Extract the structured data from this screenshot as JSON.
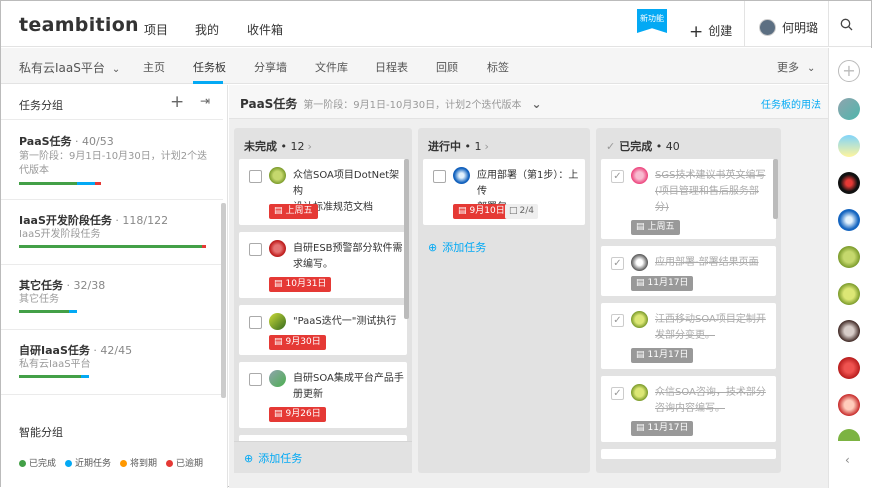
{
  "header": {
    "logo": "teambition",
    "nav": [
      "项目",
      "我的",
      "收件箱"
    ],
    "new_badge": "新功能",
    "create_label": "创建",
    "user_name": "何明璐"
  },
  "subnav": {
    "project": "私有云IaaS平台",
    "tabs": [
      "主页",
      "任务板",
      "分享墙",
      "文件库",
      "日程表",
      "回顾",
      "标签"
    ],
    "more": "更多"
  },
  "left": {
    "header": "任务分组",
    "groups": [
      {
        "name": "PaaS任务",
        "count": " · 40/53",
        "desc": "第一阶段：9月1日-10月30日，计划2个迭代版本"
      },
      {
        "name": "IaaS开发阶段任务",
        "count": " · 118/122",
        "desc": "IaaS开发阶段任务"
      },
      {
        "name": "其它任务",
        "count": " · 32/38",
        "desc": "其它任务"
      },
      {
        "name": "自研IaaS任务",
        "count": " · 42/45",
        "desc": "私有云IaaS平台"
      }
    ],
    "smart_group": "智能分组",
    "legend": [
      {
        "label": "已完成",
        "color": "#43a047"
      },
      {
        "label": "近期任务",
        "color": "#03a9f4"
      },
      {
        "label": "将到期",
        "color": "#ff9800"
      },
      {
        "label": "已逾期",
        "color": "#e53935"
      }
    ]
  },
  "board": {
    "title": "PaaS任务",
    "subtitle": "第一阶段：9月1日-10月30日，计划2个迭代版本",
    "help_link": "任务板的用法",
    "columns": [
      {
        "title": "未完成",
        "count": " • 12",
        "add": "添加任务",
        "cards": [
          {
            "l1": "众信SOA项目DotNet架构",
            "l2": "设计标准规范文档",
            "due": "上周五"
          },
          {
            "l1": "自研ESB预警部分软件需",
            "l2": "求编写。",
            "due": "10月31日"
          },
          {
            "l1": "\"PaaS迭代一\"测试执行",
            "l2": "",
            "due": "9月30日"
          },
          {
            "l1": "自研SOA集成平台产品手",
            "l2": "册更新",
            "due": "9月26日"
          }
        ]
      },
      {
        "title": "进行中",
        "count": " • 1",
        "add": "添加任务",
        "cards": [
          {
            "l1": "应用部署（第1步）：上传",
            "l2": "部署包",
            "due": "9月10日",
            "sub": "2/4"
          }
        ]
      },
      {
        "title": "已完成",
        "count": " • 40",
        "cards": [
          {
            "l1": "SGS技术建议书英文编写",
            "l2": "(项目管理和售后服务部",
            "l3": "分)",
            "due": "上周五"
          },
          {
            "l1": "应用部署-部署结果页面",
            "l2": "",
            "due": "11月17日"
          },
          {
            "l1": "江西移动SOA项目定制开",
            "l2": "发部分变更。",
            "due": "11月17日"
          },
          {
            "l1": "众信SOA咨询，技术部分",
            "l2": "咨询内容编写。",
            "due": "11月17日"
          }
        ]
      }
    ]
  },
  "colors": {
    "accent": "#03a9f4",
    "overdue": "#e53935"
  }
}
